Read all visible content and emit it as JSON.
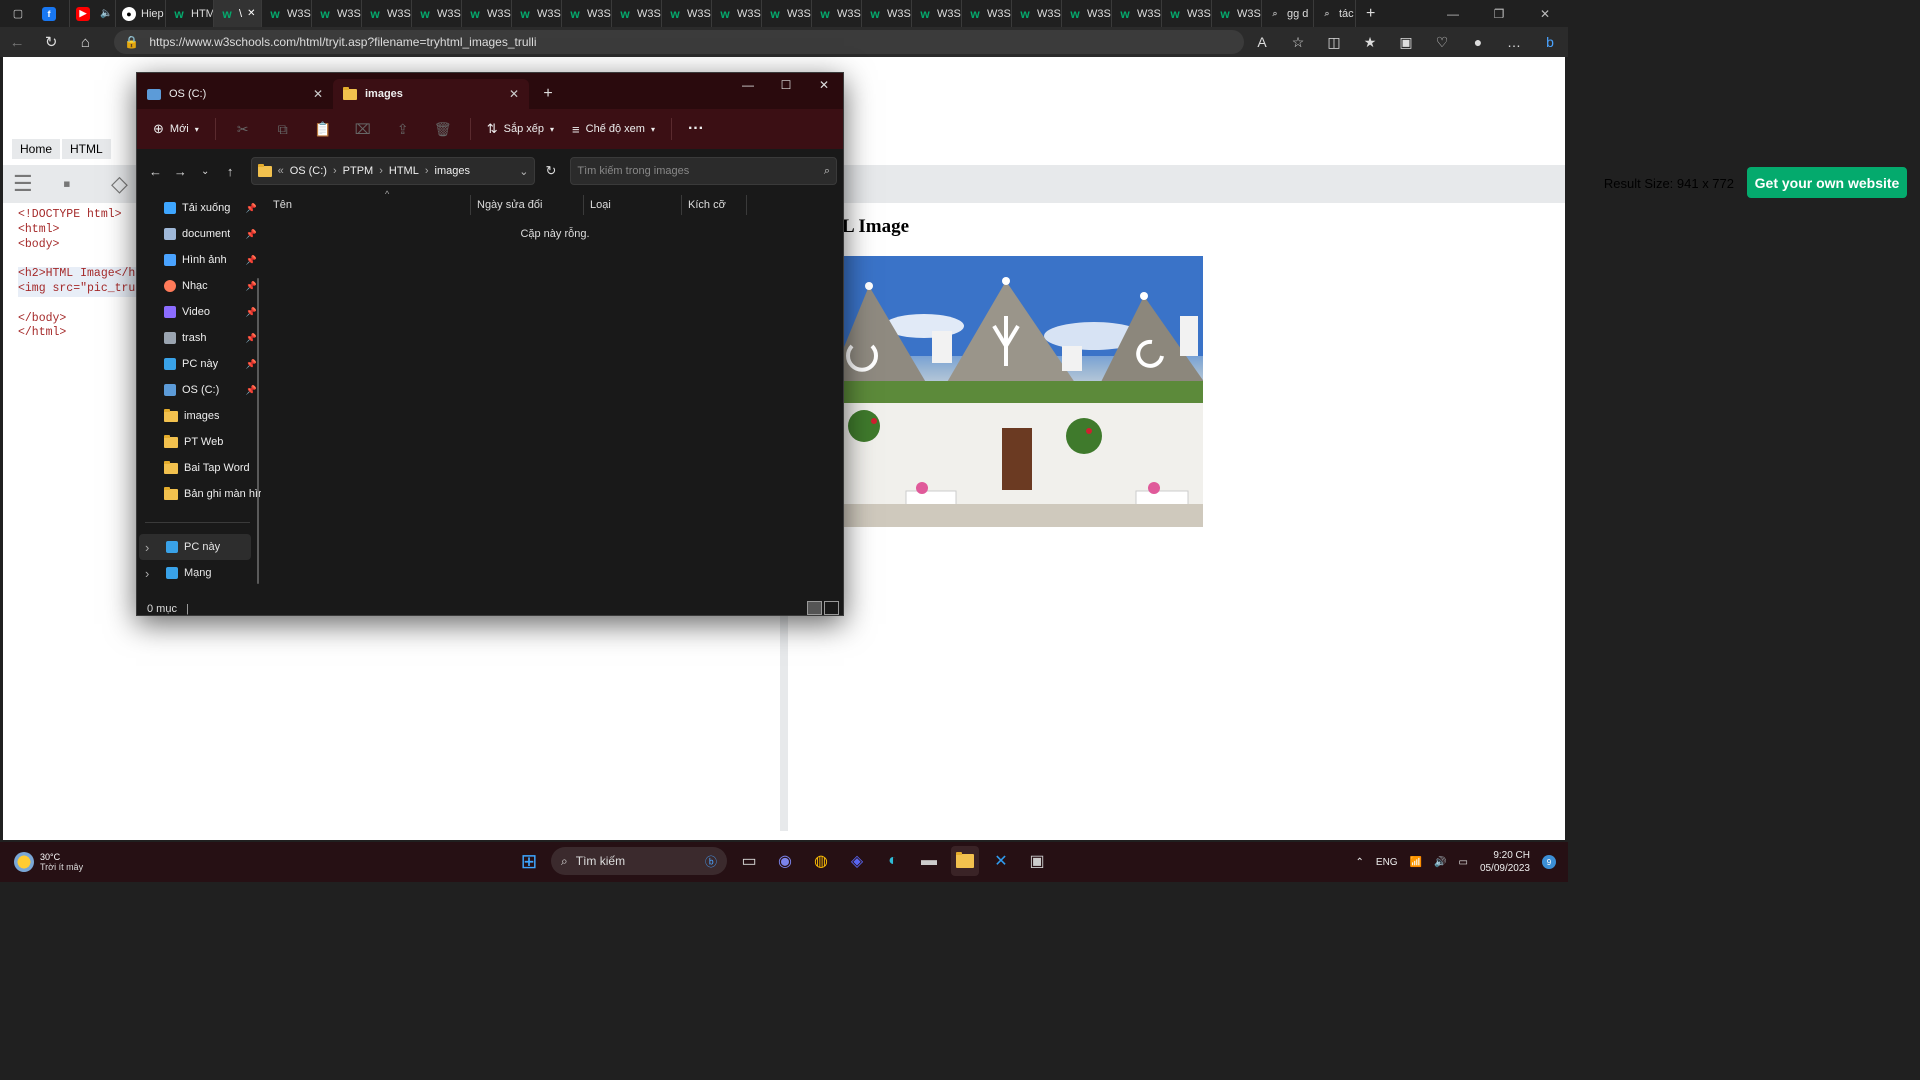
{
  "browser": {
    "tabs": [
      {
        "label": "",
        "icon": "facebook-icon",
        "color": "#1877f2"
      },
      {
        "label": "",
        "icon": "youtube-icon",
        "color": "#ff0000"
      },
      {
        "label": "Hiep",
        "icon": "github-icon",
        "color": "#ffffff"
      },
      {
        "label": "HTM",
        "icon": "w3schools-icon"
      },
      {
        "label": "\\",
        "icon": "w3schools-icon",
        "active": true
      },
      {
        "label": "W3S",
        "icon": "w3schools-icon"
      },
      {
        "label": "W3S",
        "icon": "w3schools-icon"
      },
      {
        "label": "W3S",
        "icon": "w3schools-icon"
      },
      {
        "label": "W3S",
        "icon": "w3schools-icon"
      },
      {
        "label": "W3S",
        "icon": "w3schools-icon"
      },
      {
        "label": "W3S",
        "icon": "w3schools-icon"
      },
      {
        "label": "W3S",
        "icon": "w3schools-icon"
      },
      {
        "label": "W3S",
        "icon": "w3schools-icon"
      },
      {
        "label": "W3S",
        "icon": "w3schools-icon"
      },
      {
        "label": "W3S",
        "icon": "w3schools-icon"
      },
      {
        "label": "W3S",
        "icon": "w3schools-icon"
      },
      {
        "label": "W3S",
        "icon": "w3schools-icon"
      },
      {
        "label": "W3S",
        "icon": "w3schools-icon"
      },
      {
        "label": "W3S",
        "icon": "w3schools-icon"
      },
      {
        "label": "W3S",
        "icon": "w3schools-icon"
      },
      {
        "label": "W3S",
        "icon": "w3schools-icon"
      },
      {
        "label": "W3S",
        "icon": "w3schools-icon"
      },
      {
        "label": "W3S",
        "icon": "w3schools-icon"
      },
      {
        "label": "W3S",
        "icon": "w3schools-icon"
      },
      {
        "label": "W3S",
        "icon": "w3schools-icon"
      },
      {
        "label": "gg d",
        "icon": "search-icon"
      },
      {
        "label": "tác c",
        "icon": "search-icon"
      }
    ],
    "url": "https://www.w3schools.com/html/tryit.asp?filename=tryhtml_images_trulli"
  },
  "w3": {
    "breadcrumb": [
      "Home",
      "HTML"
    ],
    "result_size": "Result Size: 941 x 772",
    "cta": "Get your own website",
    "code": [
      "<!DOCTYPE html>",
      "<html>",
      "<body>",
      "",
      "<h2>HTML Image</h2",
      "<img src=\"pic_trul",
      "",
      "</body>",
      "</html>"
    ],
    "result_heading": "L Image",
    "accent": "#04aa6d"
  },
  "explorer": {
    "tabs": [
      {
        "label": "OS (C:)",
        "icon": "drive-icon"
      },
      {
        "label": "images",
        "icon": "folder-icon",
        "active": true
      }
    ],
    "commands": {
      "new": "Mới",
      "sort": "Sắp xếp",
      "view": "Chế độ xem"
    },
    "path": [
      "OS (C:)",
      "PTPM",
      "HTML",
      "images"
    ],
    "path_overflow": "«",
    "search_placeholder": "Tìm kiếm trong images",
    "sidebar": [
      {
        "label": "Tải xuống",
        "icon": "download-icon",
        "pinned": true
      },
      {
        "label": "document",
        "icon": "document-icon",
        "pinned": true
      },
      {
        "label": "Hình ảnh",
        "icon": "pictures-icon",
        "pinned": true
      },
      {
        "label": "Nhạc",
        "icon": "music-icon",
        "pinned": true
      },
      {
        "label": "Video",
        "icon": "video-icon",
        "pinned": true
      },
      {
        "label": "trash",
        "icon": "trash-icon",
        "pinned": true
      },
      {
        "label": "PC này",
        "icon": "pc-icon",
        "pinned": true
      },
      {
        "label": "OS (C:)",
        "icon": "drive-icon",
        "pinned": true
      },
      {
        "label": "images",
        "icon": "folder-icon"
      },
      {
        "label": "PT Web",
        "icon": "folder-icon"
      },
      {
        "label": "Bai Tap Word",
        "icon": "folder-icon"
      },
      {
        "label": "Bản ghi màn hìr",
        "icon": "folder-icon"
      }
    ],
    "sidebar2": [
      {
        "label": "PC này",
        "icon": "pc-icon",
        "selected": true
      },
      {
        "label": "Mạng",
        "icon": "network-icon"
      }
    ],
    "columns": [
      "Tên",
      "Ngày sửa đổi",
      "Loại",
      "Kích cỡ"
    ],
    "empty_text": "Cặp này rỗng.",
    "status": "0 mục"
  },
  "taskbar": {
    "weather_temp": "30°C",
    "weather_desc": "Trời ít mây",
    "search_label": "Tìm kiếm",
    "lang": "ENG",
    "time": "9:20 CH",
    "date": "05/09/2023",
    "notifications": "9"
  }
}
